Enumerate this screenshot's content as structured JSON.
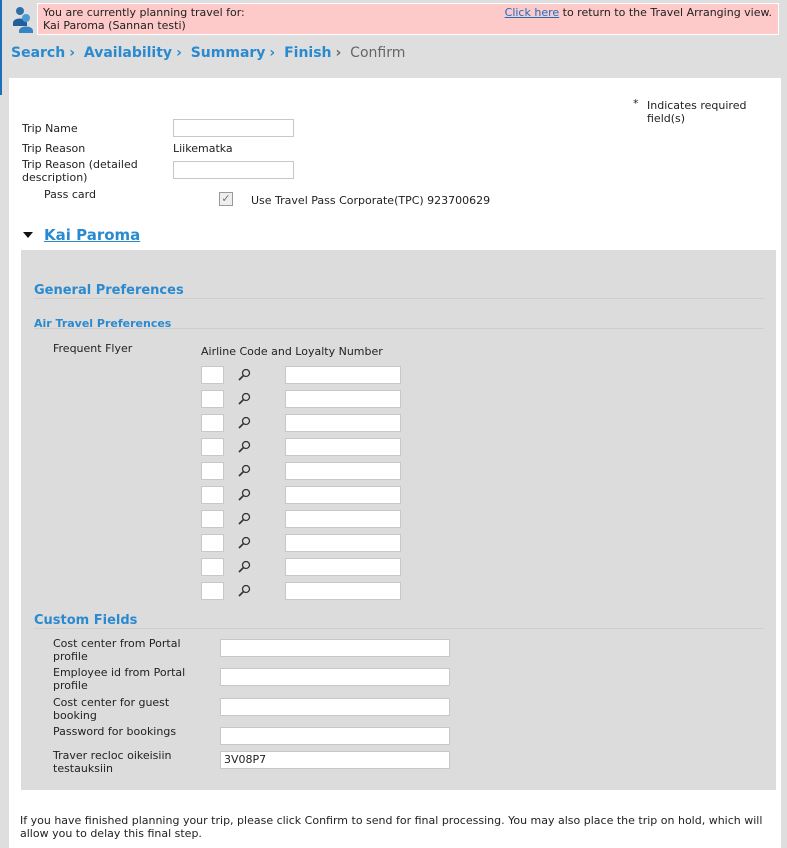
{
  "banner": {
    "line1": "You are currently planning travel for:",
    "line2": "Kai Paroma  (Sannan testi)",
    "link": "Click  here",
    "link_suffix": " to return to the Travel Arranging view."
  },
  "breadcrumb": [
    "Search",
    "Availability",
    "Summary",
    "Finish",
    "Confirm"
  ],
  "required_note": "Indicates required field(s)",
  "required_star": "*",
  "trip": {
    "name_label": "Trip Name",
    "name_value": "",
    "reason_label": "Trip Reason",
    "reason_value": "Liikematka",
    "detail_label_1": "Trip Reason (detailed",
    "detail_label_2": "description)",
    "detail_value": "",
    "pass_label": "Pass card",
    "pass_checked": true,
    "pass_text": "Use Travel Pass Corporate(TPC)  923700629"
  },
  "traveler": "Kai Paroma",
  "prefs": {
    "general": "General Preferences",
    "air": "Air Travel Preferences",
    "ff_label": "Frequent Flyer",
    "ff_header": "Airline Code and Loyalty Number",
    "rows": 10
  },
  "custom": {
    "title": "Custom Fields",
    "fields": [
      {
        "l1": "Cost center from Portal",
        "l2": "profile",
        "value": ""
      },
      {
        "l1": "Employee id from Portal",
        "l2": "profile",
        "value": ""
      },
      {
        "l1": "Cost center for guest",
        "l2": "booking",
        "value": ""
      },
      {
        "l1": "Password for bookings",
        "l2": "",
        "value": ""
      },
      {
        "l1": "Traver recloc oikeisiin",
        "l2": "testauksiin",
        "value": "3V08P7"
      }
    ]
  },
  "footer_text": "If you have finished planning your trip, please click Confirm to send for final processing. You may also place the trip on hold, which will allow you to delay this final step."
}
